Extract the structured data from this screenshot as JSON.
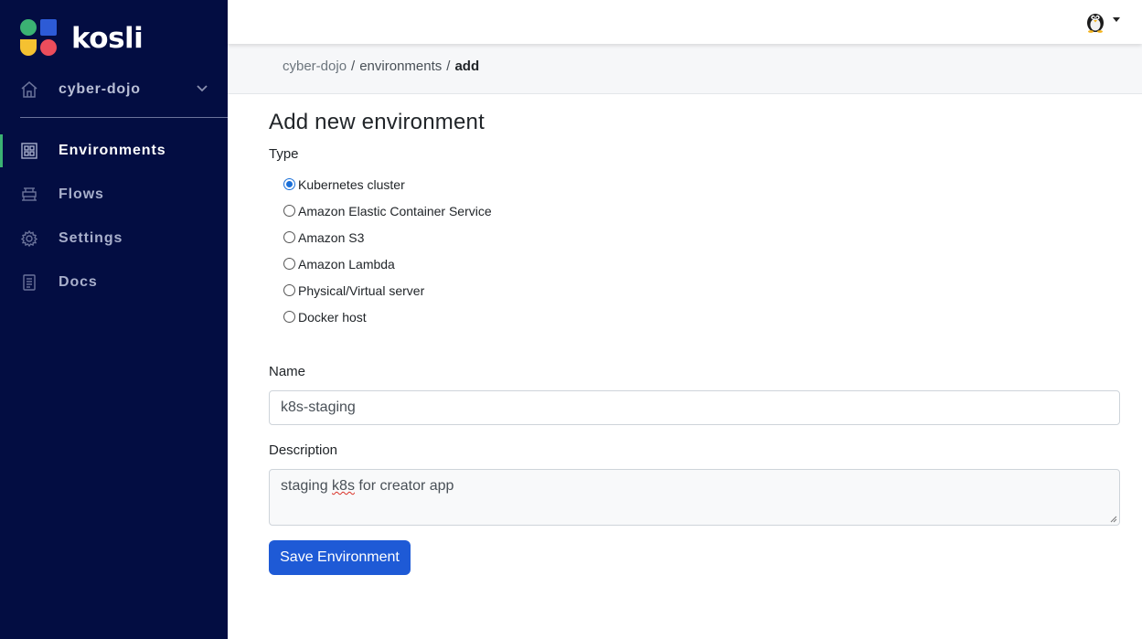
{
  "app": {
    "logo_text": "kosli"
  },
  "sidebar": {
    "org_name": "cyber-dojo",
    "items": [
      {
        "label": "Environments",
        "icon": "grid-icon",
        "active": true
      },
      {
        "label": "Flows",
        "icon": "flows-icon",
        "active": false
      },
      {
        "label": "Settings",
        "icon": "gear-icon",
        "active": false
      },
      {
        "label": "Docs",
        "icon": "document-icon",
        "active": false
      }
    ]
  },
  "breadcrumb": {
    "org": "cyber-dojo",
    "section": "environments",
    "current": "add",
    "separator": "/"
  },
  "form": {
    "title": "Add new environment",
    "type_label": "Type",
    "types": [
      {
        "label": "Kubernetes cluster",
        "checked": true
      },
      {
        "label": "Amazon Elastic Container Service",
        "checked": false
      },
      {
        "label": "Amazon S3",
        "checked": false
      },
      {
        "label": "Amazon Lambda",
        "checked": false
      },
      {
        "label": "Physical/Virtual server",
        "checked": false
      },
      {
        "label": "Docker host",
        "checked": false
      }
    ],
    "name_label": "Name",
    "name_value": "k8s-staging",
    "description_label": "Description",
    "description_value_pre": "staging ",
    "description_value_misspelled": "k8s",
    "description_value_post": " for creator app",
    "save_label": "Save Environment"
  },
  "colors": {
    "sidebar_bg": "#030d42",
    "active_indicator": "#3bb273",
    "primary_button": "#1e5ad6"
  }
}
